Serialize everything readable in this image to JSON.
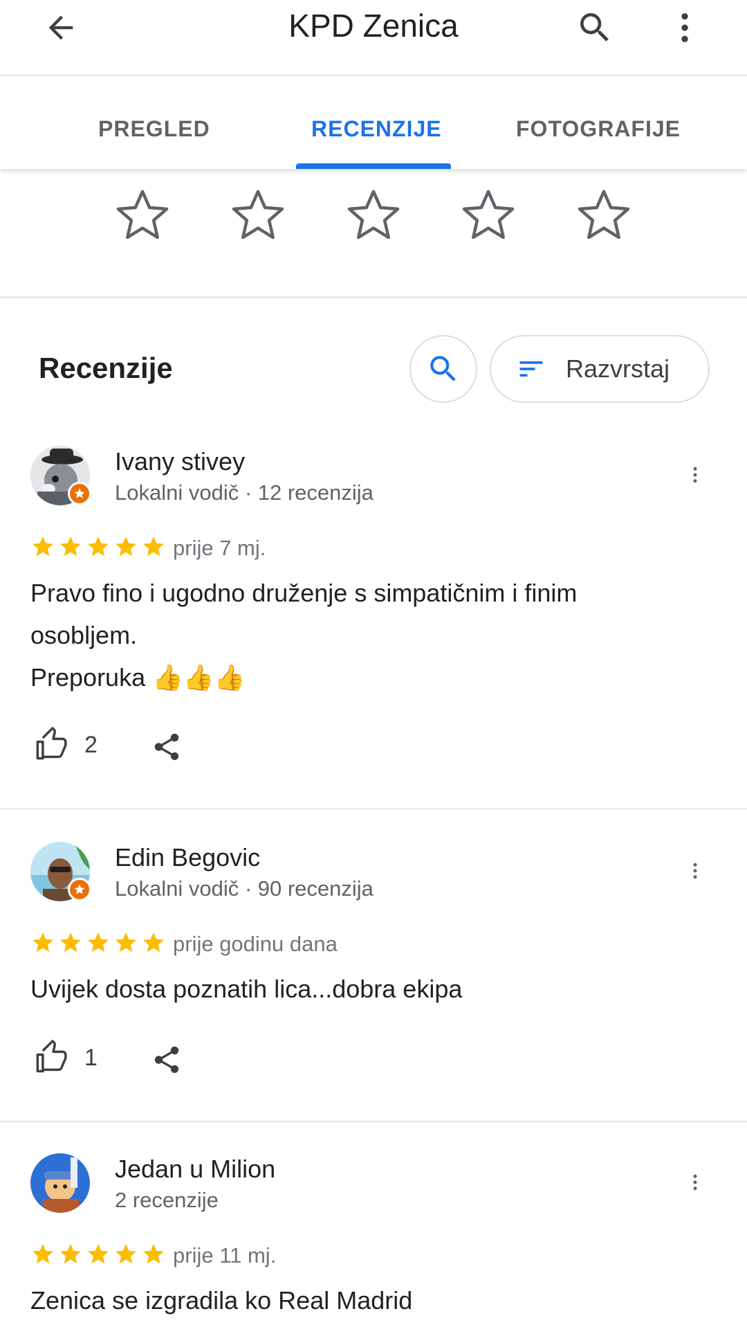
{
  "app_bar": {
    "title": "KPD Zenica",
    "back_icon": "arrow-back-icon",
    "search_icon": "search-icon",
    "more_icon": "more-vert-icon"
  },
  "tabs": [
    {
      "label": "PREGLED",
      "active": false
    },
    {
      "label": "RECENZIJE",
      "active": true
    },
    {
      "label": "FOTOGRAFIJE",
      "active": false
    }
  ],
  "rate_prompt": {
    "stars": 5,
    "icon": "star-outline-icon"
  },
  "reviews_header": {
    "title": "Recenzije",
    "search_icon": "search-icon",
    "sort_label": "Razvrstaj",
    "sort_icon": "sort-icon"
  },
  "colors": {
    "accent": "#1a73e8",
    "star": "#fbbc04",
    "badge": "#e8710a"
  },
  "reviews": [
    {
      "name": "Ivany stivey",
      "meta": "Lokalni vodič · 12 recenzija",
      "local_guide": true,
      "rating": 5,
      "date": "prije 7 mj.",
      "text": "Pravo fino i ugodno druženje s simpatičnim i finim\nosobljem.\nPreporuka 👍👍👍",
      "likes": "2"
    },
    {
      "name": "Edin Begovic",
      "meta": "Lokalni vodič · 90 recenzija",
      "local_guide": true,
      "rating": 5,
      "date": "prije godinu dana",
      "text": "Uvijek dosta poznatih lica...dobra ekipa",
      "likes": "1"
    },
    {
      "name": "Jedan u Milion",
      "meta": "2 recenzije",
      "local_guide": false,
      "rating": 5,
      "date": "prije 11 mj.",
      "text": "Zenica se izgradila ko Real Madrid"
    }
  ]
}
